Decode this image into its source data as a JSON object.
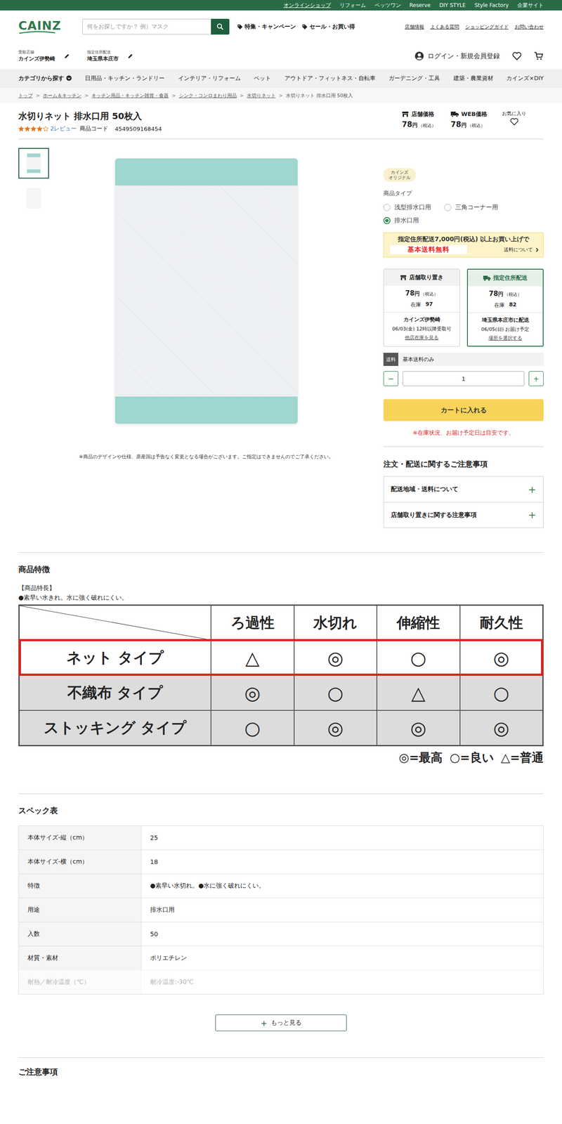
{
  "top_bar": {
    "links": [
      {
        "label": "オンラインショップ",
        "selected": true
      },
      {
        "label": "リフォーム",
        "selected": false
      },
      {
        "label": "ペッツワン",
        "selected": false
      },
      {
        "label": "Reserve",
        "selected": false
      },
      {
        "label": "DIY STYLE",
        "selected": false
      },
      {
        "label": "Style Factory",
        "selected": false
      },
      {
        "label": "企業サイト",
        "selected": false
      }
    ]
  },
  "header": {
    "logo": "CAINZ",
    "search_placeholder": "何をお探しですか？ 例）マスク",
    "nav": [
      "特集・キャンペーン",
      "セール・お買い得"
    ],
    "links": [
      "店舗情報",
      "よくある質問",
      "ショッピングガイド",
      "お問い合わせ"
    ]
  },
  "location": {
    "store_label": "受取店舗",
    "store": "カインズ伊勢崎",
    "address_label": "指定住所配送",
    "address": "埼玉県本庄市"
  },
  "account": {
    "login": "ログイン・新規会員登録"
  },
  "categories": {
    "title": "カテゴリから探す",
    "items": [
      "日用品・キッチン・ランドリー",
      "インテリア・リフォーム",
      "ペット",
      "アウトドア・フィットネス・自転車",
      "ガーデニング・工具",
      "建築・農業資材",
      "カインズ×DIY"
    ]
  },
  "breadcrumb": {
    "separator": ">",
    "items": [
      {
        "label": "トップ",
        "link": true
      },
      {
        "label": "ホーム＆キッチン",
        "link": true
      },
      {
        "label": "キッチン用品・キッチン雑貨・食器",
        "link": true
      },
      {
        "label": "シンク・コンロまわり用品",
        "link": true
      },
      {
        "label": "水切りネット",
        "link": true
      },
      {
        "label": "水切りネット 排水口用 50枚入",
        "link": false
      }
    ]
  },
  "product": {
    "title": "水切りネット 排水口用 50枚入",
    "stars": 4,
    "reviews": "2レビュー",
    "code_label": "商品コード",
    "code": "4549509168454",
    "prices": [
      {
        "label": "店舗価格",
        "kind": "store",
        "price": "78",
        "unit": "円",
        "tax": "（税込）"
      },
      {
        "label": "WEB価格",
        "kind": "web",
        "price": "78",
        "unit": "円",
        "tax": "（税込）"
      }
    ],
    "favorite": "お気に入り",
    "thumbnails": [
      {
        "selected": true
      },
      {
        "selected": false
      }
    ],
    "image_note": "※商品のデザインや仕様、原産国は予告なく変更となる場合がございます。ご指定はできませんのでご了承ください。"
  },
  "badge_lines": [
    "カインズ",
    "オリジナル"
  ],
  "type_select": {
    "label": "商品タイプ",
    "options": [
      {
        "label": "浅型排水口用",
        "selected": false
      },
      {
        "label": "三角コーナー用",
        "selected": false
      },
      {
        "label": "排水口用",
        "selected": true
      }
    ]
  },
  "banner": {
    "line1": "指定住所配送7,000円(税込) 以上お買い上げで",
    "highlight": "基本送料無料",
    "link": "送料について"
  },
  "delivery_options": [
    {
      "title": "店舗取り置き",
      "kind": "store",
      "price": "78",
      "unit": "円",
      "tax": "（税込）",
      "stock_label": "在庫",
      "stock": "97",
      "place": "カインズ伊勢崎",
      "date": "06/03(金) 12時以降受取可",
      "link": "他店在庫を見る",
      "selected": false
    },
    {
      "title": "指定住所配送",
      "kind": "web",
      "price": "78",
      "unit": "円",
      "tax": "（税込）",
      "stock_label": "在庫",
      "stock": "82",
      "place": "埼玉県本庄市に配送",
      "date": "06/05(日) お届け予定",
      "link": "場所を選択する",
      "selected": true
    }
  ],
  "shipping": {
    "tag": "送料",
    "text": "基本送料のみ"
  },
  "quantity": {
    "minus": "−",
    "value": "1",
    "plus": "+"
  },
  "cart_button": "カートに入れる",
  "stock_note": "※在庫状況、お届け予定日は目安です。",
  "notices": {
    "title": "注文・配送に関するご注意事項",
    "items": [
      {
        "label": "配送地域・送料について",
        "icon": "+",
        "expanded": false
      },
      {
        "label": "店舗取り置きに関する注意事項",
        "icon": "+",
        "expanded": false
      }
    ]
  },
  "features": {
    "title": "商品特徴",
    "heading": "【商品特長】",
    "text": "●素早い水きれ。水に強く破れにくい。",
    "comparison": {
      "columns": [
        "ろ過性",
        "水切れ",
        "伸縮性",
        "耐久性"
      ],
      "rows": [
        {
          "label": "ネット タイプ",
          "values": [
            "△",
            "◎",
            "○",
            "◎"
          ],
          "selected": true
        },
        {
          "label": "不織布 タイプ",
          "values": [
            "◎",
            "○",
            "△",
            "○"
          ],
          "selected": false
        },
        {
          "label": "ストッキング タイプ",
          "values": [
            "○",
            "◎",
            "◎",
            "◎"
          ],
          "selected": false
        }
      ],
      "legend": [
        "◎=最高",
        "○=良い",
        "△=普通"
      ]
    }
  },
  "specs": {
    "title": "スペック表",
    "rows": [
      {
        "label": "本体サイズ-縦（cm）",
        "value": "25",
        "faded": false
      },
      {
        "label": "本体サイズ-横（cm）",
        "value": "18",
        "faded": false
      },
      {
        "label": "特徴",
        "value": "●素早い水切れ。●水に強く破れにくい。",
        "faded": false
      },
      {
        "label": "用途",
        "value": "排水口用",
        "faded": false
      },
      {
        "label": "入数",
        "value": "50",
        "faded": false
      },
      {
        "label": "材質・素材",
        "value": "ポリエチレン",
        "faded": false
      },
      {
        "label": "耐熱／耐冷温度（℃）",
        "value": "耐冷温度:-30℃",
        "faded": true
      }
    ],
    "more_button": {
      "icon": "+",
      "label": "もっと見る"
    }
  },
  "notes": {
    "title": "ご注意事項"
  }
}
